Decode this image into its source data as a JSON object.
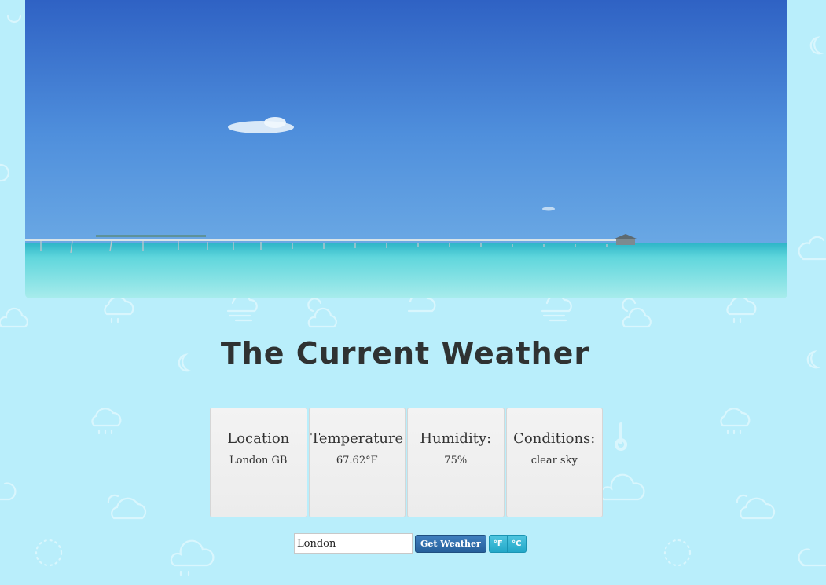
{
  "page": {
    "title": "The Current Weather"
  },
  "cards": [
    {
      "label": "Location",
      "value": "London GB"
    },
    {
      "label": "Temperature",
      "value": "67.62°F"
    },
    {
      "label": "Humidity:",
      "value": "75%"
    },
    {
      "label": "Conditions:",
      "value": "clear sky"
    }
  ],
  "controls": {
    "city_input_value": "London",
    "get_weather_label": "Get Weather",
    "fahrenheit_label": "°F",
    "celsius_label": "°C"
  },
  "colors": {
    "background": "#b9eefb",
    "sky_top": "#2f66c4",
    "sky_bottom": "#5a9ee0",
    "sea": "#5fd3d8",
    "get_weather_button": "#26609b",
    "unit_button": "#23a8c8"
  },
  "icons": [
    "cloud-rain-icon",
    "moon-icon",
    "sun-cloud-icon",
    "wind-cloud-icon",
    "thermometer-icon",
    "cloud-icon"
  ]
}
